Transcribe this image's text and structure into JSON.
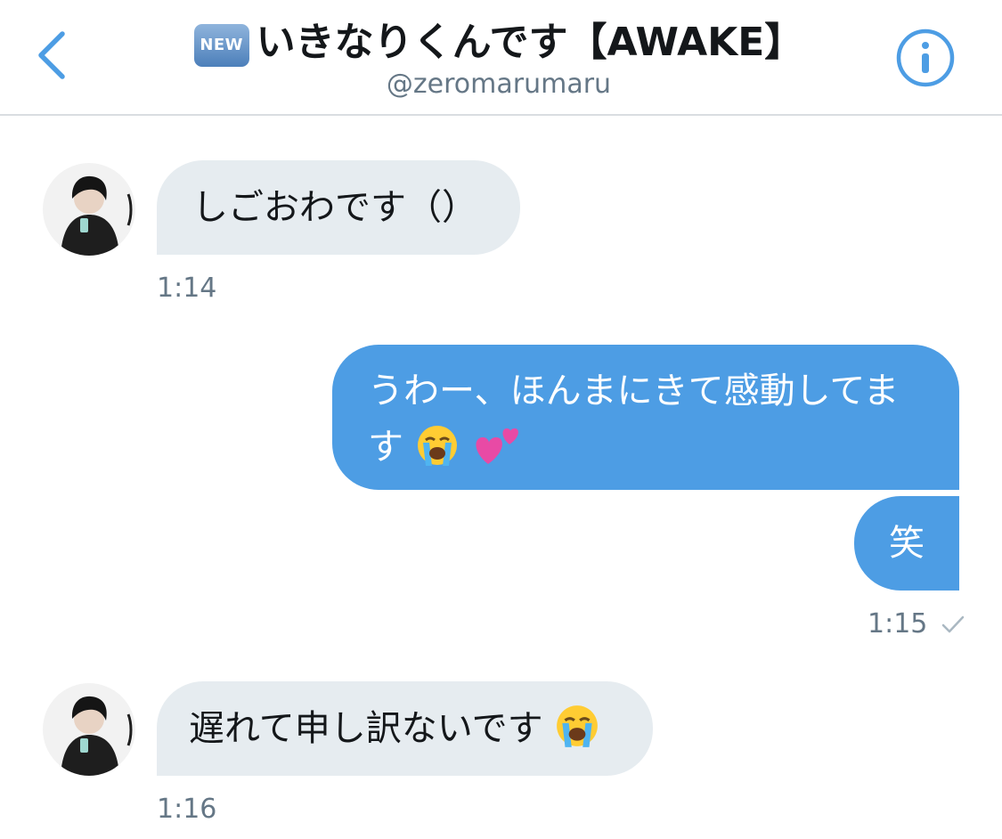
{
  "header": {
    "badge": "NEW",
    "title": "いきなりくんです【AWAKE】",
    "handle": "@zeromarumaru"
  },
  "icons": {
    "back": "chevron-left-icon",
    "info": "info-circle-icon",
    "badge": "new-button-emoji",
    "crying": "loudly-crying-face-emoji",
    "hearts": "two-hearts-emoji",
    "read": "checkmark-icon"
  },
  "colors": {
    "accent": "#4d9de4",
    "incoming_bubble": "#e6ecf0",
    "text": "#14171a",
    "muted": "#657786"
  },
  "messages": [
    {
      "direction": "incoming",
      "text": "しごおわです（）",
      "time": "1:14"
    },
    {
      "direction": "outgoing",
      "line1": "うわー、ほんまにきて感動してま",
      "line2": "す"
    },
    {
      "direction": "outgoing",
      "text": "笑",
      "time": "1:15"
    },
    {
      "direction": "incoming",
      "text": "遅れて申し訳ないです",
      "time": "1:16"
    }
  ]
}
